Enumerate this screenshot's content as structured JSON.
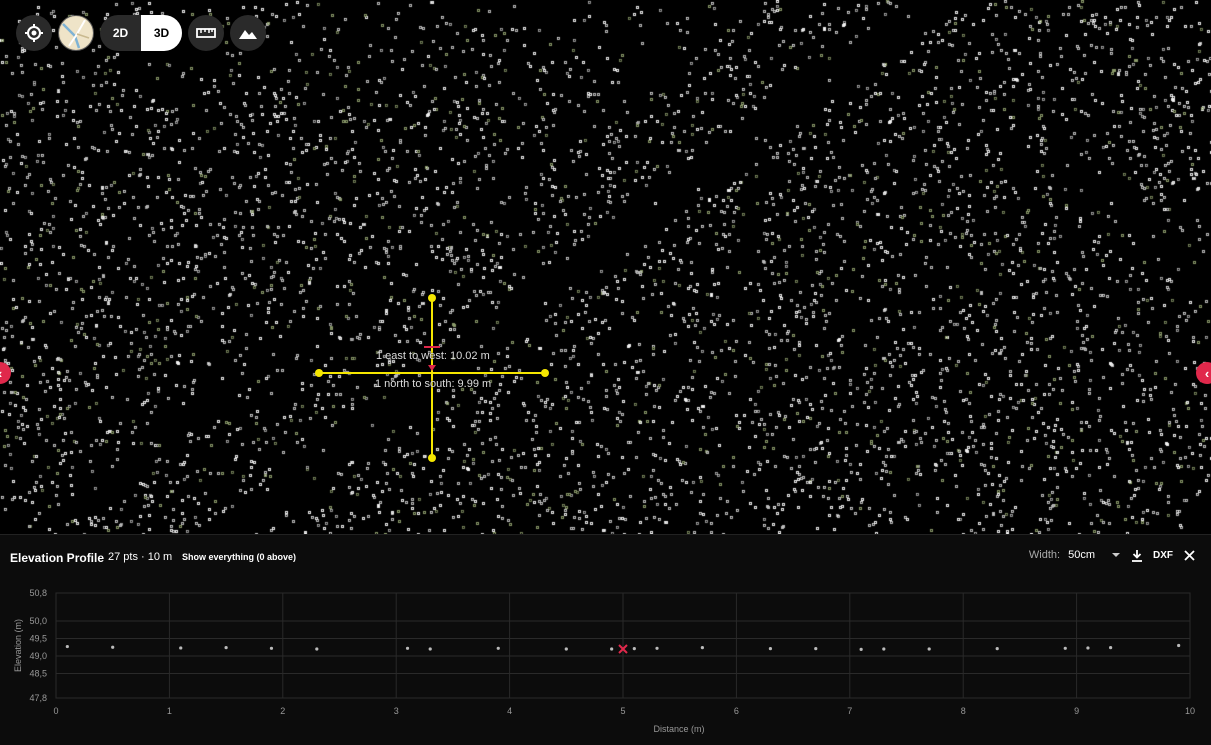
{
  "toolbar": {
    "locate_icon": "crosshair-target-icon",
    "basemap_icon": "map-thumbnail-icon",
    "mode_2d": "2D",
    "mode_3d": "3D",
    "active_mode": "3D",
    "measure_icon": "ruler-icon",
    "profile_icon": "mountain-icon"
  },
  "viewport": {
    "left_toggle_icon": "chevron-icon",
    "right_toggle_icon": "chevron-left-icon",
    "measure_label_ew": "1 east to west: 10.02 m",
    "measure_label_ns": "1 north to south: 9.99 m",
    "measure_color": "#f5e600"
  },
  "panel": {
    "title": "Elevation Profile",
    "stats": "27 pts · 10 m",
    "show_everything": "Show everything (0 above)",
    "width_label": "Width:",
    "width_value": "50cm",
    "download_icon": "download-icon",
    "dxf_label": "DXF",
    "close_icon": "close-icon"
  },
  "chart_data": {
    "type": "scatter",
    "xlabel": "Distance (m)",
    "ylabel": "Elevation (m)",
    "xlim": [
      0,
      10
    ],
    "ylim": [
      47.8,
      50.8
    ],
    "x_ticks": [
      "0",
      "1",
      "2",
      "3",
      "4",
      "5",
      "6",
      "7",
      "8",
      "9",
      "10"
    ],
    "y_ticks": [
      "50,8",
      "50,0",
      "49,5",
      "49,0",
      "48,5",
      "47,8"
    ],
    "y_tick_values": [
      50.8,
      50.0,
      49.5,
      49.0,
      48.5,
      47.8
    ],
    "grid": true,
    "points": [
      {
        "x": 0.1,
        "y": 49.27
      },
      {
        "x": 0.5,
        "y": 49.25
      },
      {
        "x": 1.1,
        "y": 49.23
      },
      {
        "x": 1.5,
        "y": 49.24
      },
      {
        "x": 1.9,
        "y": 49.22
      },
      {
        "x": 2.3,
        "y": 49.2
      },
      {
        "x": 3.1,
        "y": 49.22
      },
      {
        "x": 3.3,
        "y": 49.2
      },
      {
        "x": 3.9,
        "y": 49.22
      },
      {
        "x": 4.5,
        "y": 49.2
      },
      {
        "x": 4.9,
        "y": 49.2
      },
      {
        "x": 5.1,
        "y": 49.21
      },
      {
        "x": 5.3,
        "y": 49.22
      },
      {
        "x": 5.7,
        "y": 49.24
      },
      {
        "x": 6.3,
        "y": 49.21
      },
      {
        "x": 6.7,
        "y": 49.21
      },
      {
        "x": 7.1,
        "y": 49.19
      },
      {
        "x": 7.3,
        "y": 49.2
      },
      {
        "x": 7.7,
        "y": 49.2
      },
      {
        "x": 8.3,
        "y": 49.21
      },
      {
        "x": 8.9,
        "y": 49.22
      },
      {
        "x": 9.1,
        "y": 49.23
      },
      {
        "x": 9.3,
        "y": 49.24
      },
      {
        "x": 9.9,
        "y": 49.3
      }
    ],
    "marker": {
      "x": 5.0,
      "y": 49.2,
      "color": "#e0284b"
    }
  }
}
